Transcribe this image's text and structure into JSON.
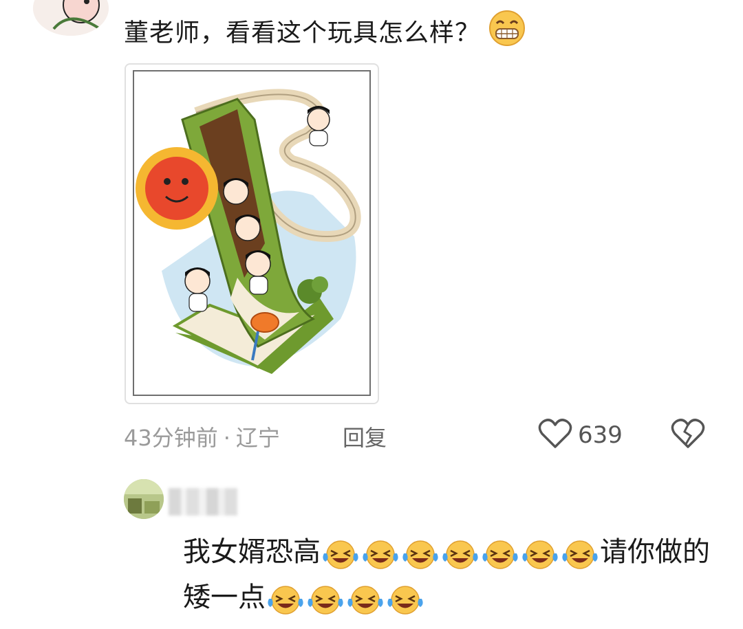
{
  "comment": {
    "text": "董老师，看看这个玩具怎么样？",
    "emoji": "grinning-face-icon",
    "time": "43分钟前",
    "separator": "·",
    "location": "辽宁",
    "reply_label": "回复",
    "like_count": "639",
    "like_icon": "heart-outline-icon",
    "dislike_icon": "broken-heart-icon"
  },
  "reply": {
    "text_part1": "我女婿恐高",
    "laugh_count_1": 7,
    "text_part2": "请你做的矮一点",
    "laugh_count_2": 4,
    "emoji": "face-with-tears-of-joy-icon"
  },
  "colors": {
    "meta_gray": "#9a9a9a",
    "slide_green": "#7ea83a",
    "sun_orange": "#e8482c",
    "track_beige": "#e8d8b8"
  }
}
